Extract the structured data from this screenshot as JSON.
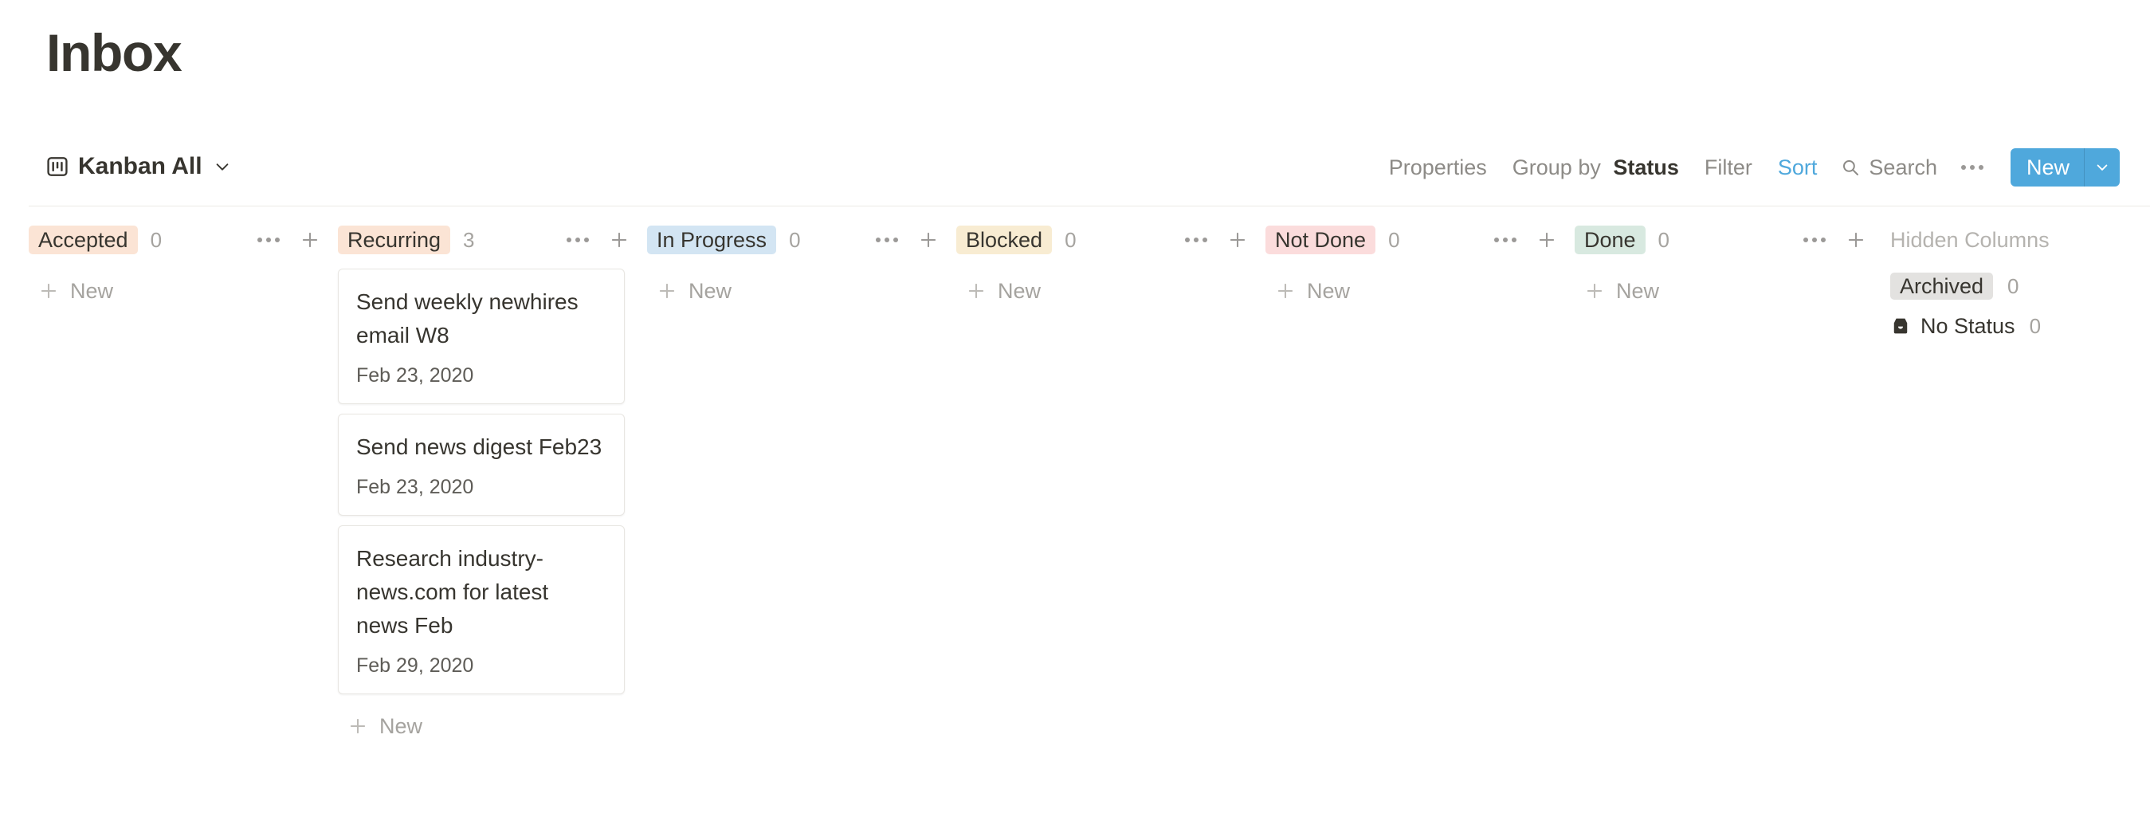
{
  "header": {
    "title": "Inbox",
    "view": {
      "icon": "board-icon",
      "label": "Kanban All",
      "chevron": "chevron-down-icon"
    }
  },
  "toolbar": {
    "properties_label": "Properties",
    "group_by_prefix": "Group by",
    "group_by_value": "Status",
    "filter_label": "Filter",
    "sort_label": "Sort",
    "search_label": "Search",
    "search_icon": "search-icon",
    "more_icon": "ellipsis-icon",
    "new_label": "New",
    "new_caret_icon": "chevron-down-icon",
    "accent_color": "#4fa8dc",
    "sort_color": "#4fa8dc"
  },
  "board": {
    "add_label": "New",
    "column_menu_icon": "ellipsis-icon",
    "column_add_icon": "plus-icon",
    "columns": [
      {
        "name": "Accepted",
        "count": "0",
        "tag_bg": "#fbe4d5",
        "cards": []
      },
      {
        "name": "Recurring",
        "count": "3",
        "tag_bg": "#fbe4d5",
        "cards": [
          {
            "title": "Send weekly newhires email W8",
            "date": "Feb 23, 2020"
          },
          {
            "title": "Send news digest Feb23",
            "date": "Feb 23, 2020"
          },
          {
            "title": "Research industry-news.com for latest news Feb",
            "date": "Feb 29, 2020"
          }
        ]
      },
      {
        "name": "In Progress",
        "count": "0",
        "tag_bg": "#d3e5f3",
        "cards": []
      },
      {
        "name": "Blocked",
        "count": "0",
        "tag_bg": "#f8ecd2",
        "cards": []
      },
      {
        "name": "Not Done",
        "count": "0",
        "tag_bg": "#fbdcdc",
        "cards": []
      },
      {
        "name": "Done",
        "count": "0",
        "tag_bg": "#d8e9e0",
        "cards": []
      }
    ]
  },
  "hidden_columns": {
    "title": "Hidden Columns",
    "items": [
      {
        "label": "Archived",
        "count": "0",
        "tag_bg": "#e3e2e0",
        "icon": null
      },
      {
        "label": "No Status",
        "count": "0",
        "tag_bg": "transparent",
        "icon": "inbox-icon"
      }
    ]
  }
}
